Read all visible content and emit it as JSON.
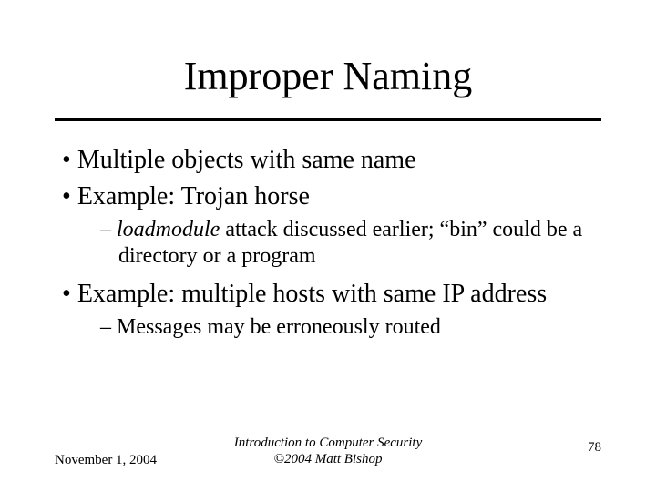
{
  "title": "Improper Naming",
  "bullets": {
    "b0": "Multiple objects with same name",
    "b1": "Example: Trojan horse",
    "b1s_em": "loadmodule",
    "b1s_rest": " attack discussed earlier; “bin” could be a directory or a program",
    "b2": "Example: multiple hosts with same IP address",
    "b2s": "Messages may be erroneously routed"
  },
  "footer": {
    "date": "November 1, 2004",
    "center_line1": "Introduction to Computer Security",
    "center_line2": "©2004 Matt Bishop",
    "page": "78"
  }
}
